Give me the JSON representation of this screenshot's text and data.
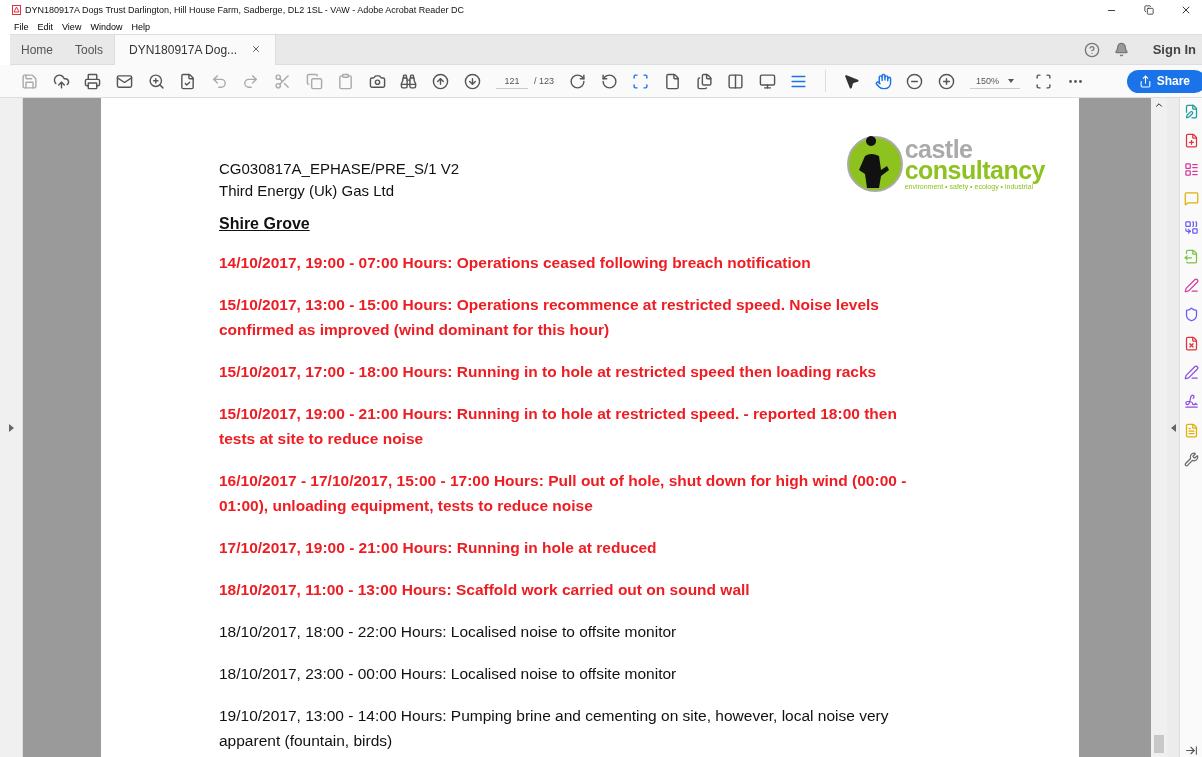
{
  "window": {
    "title": "DYN180917A Dogs Trust Darlington, Hill House Farm, Sadberge, DL2 1SL - VAW - Adobe Acrobat Reader DC"
  },
  "menu": [
    "File",
    "Edit",
    "View",
    "Window",
    "Help"
  ],
  "tabs": [
    {
      "label": "Home",
      "selected": false
    },
    {
      "label": "Tools",
      "selected": false
    },
    {
      "label": "DYN180917A Dog...",
      "selected": true,
      "closable": true
    }
  ],
  "sign_in": "Sign In",
  "toolbar": {
    "page": "121",
    "page_total": "/ 123",
    "zoom": "150%",
    "share": "Share"
  },
  "document": {
    "logo": {
      "line1": "castle",
      "line2": "consultancy",
      "tagline": "environment • safety • ecology • industrial"
    },
    "ref": "CG030817A_EPHASE/PRE_S/1 V2",
    "company": "Third Energy (Uk) Gas Ltd",
    "heading": "Shire Grove",
    "entries": [
      {
        "text": "14/10/2017, 19:00 - 07:00 Hours: Operations ceased following breach notification",
        "color": "#ee1d23",
        "bold": true
      },
      {
        "text": "15/10/2017, 13:00 - 15:00 Hours: Operations recommence at restricted speed. Noise levels confirmed as improved (wind dominant for this hour)",
        "color": "#ee1d23",
        "bold": true
      },
      {
        "text": "15/10/2017, 17:00 - 18:00 Hours: Running in to hole at restricted speed then loading racks",
        "color": "#ee1d23",
        "bold": true
      },
      {
        "text": "15/10/2017, 19:00 - 21:00 Hours: Running in to hole at restricted speed. - reported 18:00 then tests at site to reduce noise",
        "color": "#ee1d23",
        "bold": true
      },
      {
        "text": "16/10/2017 - 17/10/2017, 15:00 - 17:00 Hours: Pull out of hole, shut down for high wind (00:00 - 01:00), unloading equipment, tests to reduce noise",
        "color": "#ee1d23",
        "bold": true
      },
      {
        "text": "17/10/2017, 19:00 - 21:00 Hours: Running in hole at reduced",
        "color": "#ee1d23",
        "bold": true
      },
      {
        "text": "18/10/2017, 11:00 - 13:00 Hours: Scaffold work carried out on sound wall",
        "color": "#ee1d23",
        "bold": true
      },
      {
        "text": "18/10/2017, 18:00 - 22:00 Hours: Localised noise to offsite monitor",
        "color": "#111111",
        "bold": false
      },
      {
        "text": "18/10/2017, 23:00 - 00:00 Hours: Localised noise to offsite monitor",
        "color": "#111111",
        "bold": false
      },
      {
        "text": "19/10/2017, 13:00 - 14:00 Hours: Pumping brine and cementing on site, however, local noise very apparent (fountain, birds)",
        "color": "#111111",
        "bold": false
      }
    ]
  }
}
